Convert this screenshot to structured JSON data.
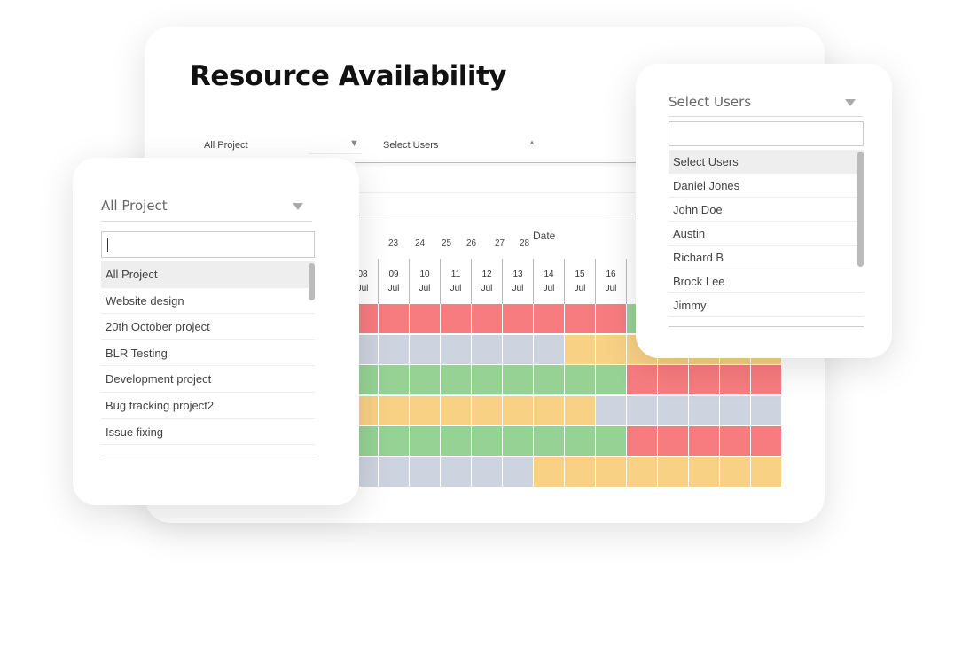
{
  "title": "Resource Availability",
  "filters": {
    "project": "All Project",
    "users": "Select Users"
  },
  "date_label": "Date",
  "top_days": [
    "23",
    "24",
    "25",
    "26",
    "27",
    "28"
  ],
  "columns": [
    {
      "day": "08",
      "month": "Jul"
    },
    {
      "day": "09",
      "month": "Jul"
    },
    {
      "day": "10",
      "month": "Jul"
    },
    {
      "day": "11",
      "month": "Jul"
    },
    {
      "day": "12",
      "month": "Jul"
    },
    {
      "day": "13",
      "month": "Jul"
    },
    {
      "day": "14",
      "month": "Jul"
    },
    {
      "day": "15",
      "month": "Jul"
    },
    {
      "day": "16",
      "month": "Jul"
    }
  ],
  "colors": {
    "busy": "#f77c7f",
    "unassigned": "#cdd3df",
    "available": "#97d295",
    "partial": "#f8d185"
  },
  "rows": [
    [
      "busy",
      "busy",
      "busy",
      "busy",
      "busy",
      "busy",
      "busy",
      "busy",
      "busy",
      "available",
      "available",
      "available",
      "available",
      "available"
    ],
    [
      "unassigned",
      "unassigned",
      "unassigned",
      "unassigned",
      "unassigned",
      "unassigned",
      "unassigned",
      "partial",
      "partial",
      "partial",
      "partial",
      "partial",
      "partial",
      "partial"
    ],
    [
      "available",
      "available",
      "available",
      "available",
      "available",
      "available",
      "available",
      "available",
      "available",
      "busy",
      "busy",
      "busy",
      "busy",
      "busy"
    ],
    [
      "partial",
      "partial",
      "partial",
      "partial",
      "partial",
      "partial",
      "partial",
      "partial",
      "unassigned",
      "unassigned",
      "unassigned",
      "unassigned",
      "unassigned",
      "unassigned"
    ],
    [
      "available",
      "available",
      "available",
      "available",
      "available",
      "available",
      "available",
      "available",
      "available",
      "busy",
      "busy",
      "busy",
      "busy",
      "busy"
    ],
    [
      "unassigned",
      "unassigned",
      "unassigned",
      "unassigned",
      "unassigned",
      "unassigned",
      "partial",
      "partial",
      "partial",
      "partial",
      "partial",
      "partial",
      "partial",
      "partial"
    ]
  ],
  "project_dropdown": {
    "label": "All Project",
    "search_value": "",
    "options": [
      "All Project",
      "Website design",
      "20th October project",
      "BLR Testing",
      "Development project",
      "Bug tracking project2",
      "Issue fixing"
    ]
  },
  "users_dropdown": {
    "label": "Select Users",
    "search_value": "",
    "options": [
      "Select Users",
      "Daniel Jones",
      "John Doe",
      "Austin",
      "Richard B",
      "Brock Lee",
      "Jimmy"
    ]
  }
}
